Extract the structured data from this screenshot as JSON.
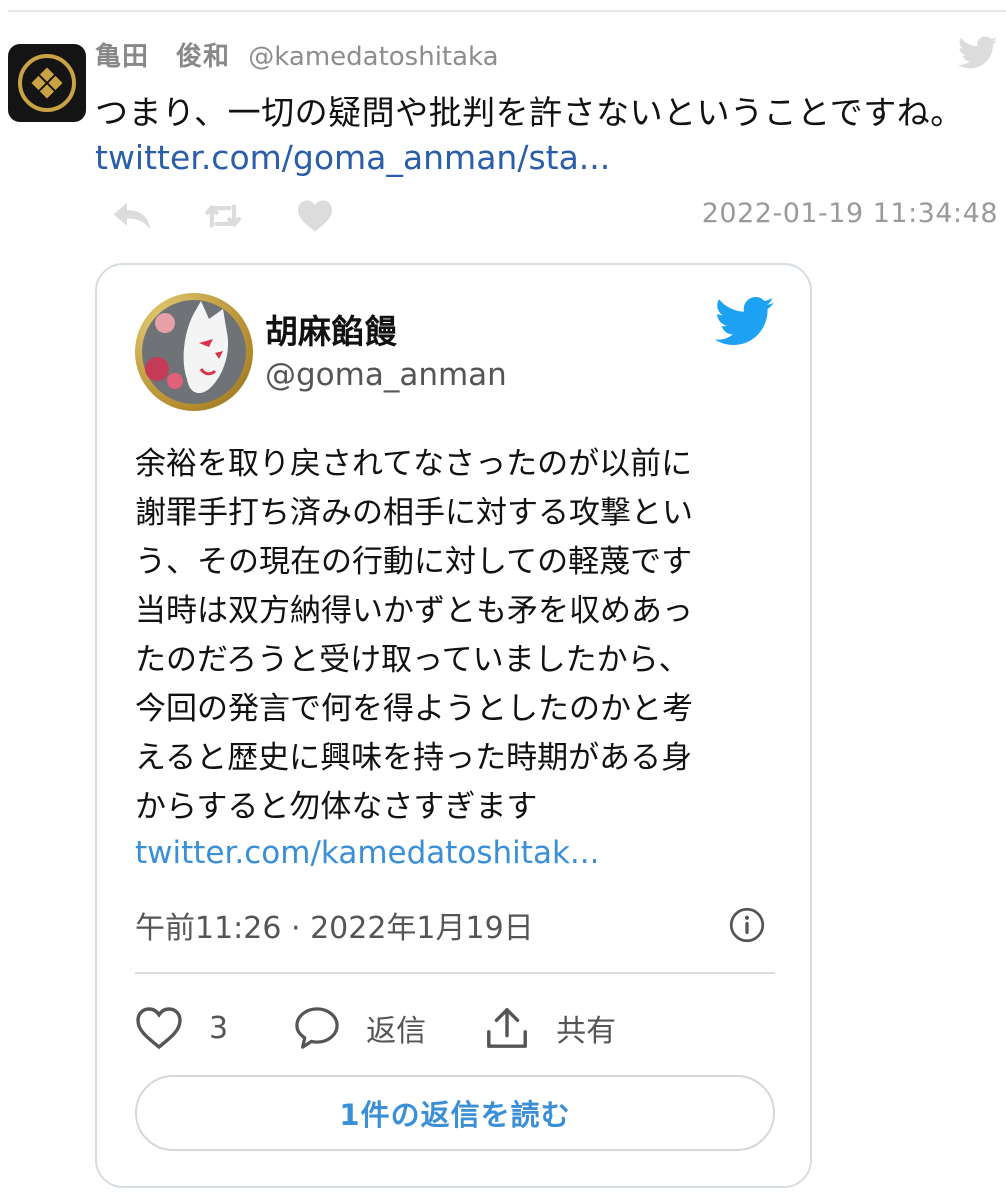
{
  "tweet": {
    "author_name": "亀田　俊和",
    "author_handle": "@kamedatoshitaka",
    "text": "つまり、一切の疑問や批判を許さないということですね。",
    "link": "twitter.com/goma_anman/sta...",
    "timestamp": "2022-01-19 11:34:48",
    "icons": [
      "reply-icon",
      "retweet-icon",
      "like-icon",
      "twitter-bird-icon"
    ]
  },
  "quoted": {
    "author_name": "胡麻餡饅",
    "author_handle": "@goma_anman",
    "lines": [
      "余裕を取り戻されてなさったのが以前に",
      "謝罪手打ち済みの相手に対する攻撃とい",
      "う、その現在の行動に対しての軽蔑です",
      "当時は双方納得いかずとも矛を収めあっ",
      "たのだろうと受け取っていましたから、",
      "今回の発言で何を得ようとしたのかと考",
      "えると歴史に興味を持った時期がある身",
      "からすると勿体なさすぎます"
    ],
    "link": "twitter.com/kamedatoshitak...",
    "time": "午前11:26 · 2022年1月19日",
    "like_count": "3",
    "reply_label": "返信",
    "share_label": "共有",
    "read_replies_label": "1件の返信を読む",
    "colors": {
      "link": "#3a8fd6",
      "bird": "#1da1f2"
    }
  }
}
